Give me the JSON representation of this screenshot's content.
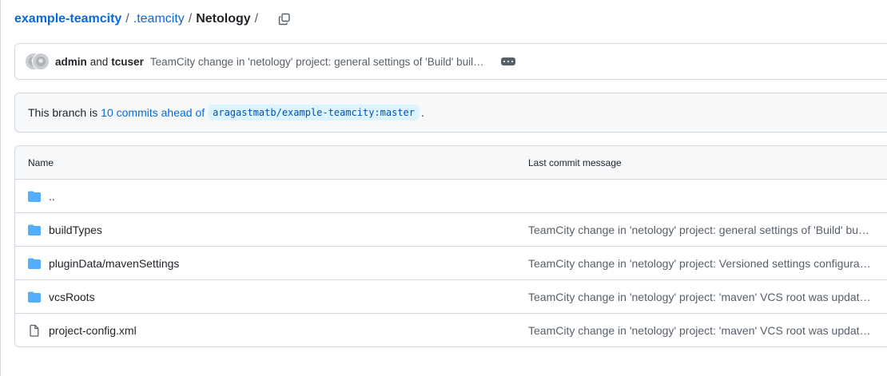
{
  "breadcrumb": {
    "repo": "example-teamcity",
    "sep1": "/",
    "folder": ".teamcity",
    "sep2": "/",
    "current": "Netology",
    "sep3": "/",
    "copy_icon": "copy-icon"
  },
  "commit": {
    "author1": "admin",
    "and": "and",
    "author2": "tcuser",
    "message": "TeamCity change in 'netology' project: general settings of 'Build' build configuration were updated",
    "more_icon": "ellipsis-icon"
  },
  "branch": {
    "prefix": "This branch is",
    "ahead": "10 commits ahead of",
    "ref": "aragastmatb/example-teamcity:master",
    "suffix": "."
  },
  "table": {
    "header_name": "Name",
    "header_msg": "Last commit message",
    "rows": [
      {
        "name": "..",
        "type": "folder",
        "message": ""
      },
      {
        "name": "buildTypes",
        "type": "folder",
        "message": "TeamCity change in 'netology' project: general settings of 'Build' build configuration were updated"
      },
      {
        "name": "pluginData/mavenSettings",
        "type": "folder",
        "message": "TeamCity change in 'netology' project: Versioned settings configuration updated"
      },
      {
        "name": "vcsRoots",
        "type": "folder",
        "message": "TeamCity change in 'netology' project: 'maven' VCS root was updated"
      },
      {
        "name": "project-config.xml",
        "type": "file",
        "message": "TeamCity change in 'netology' project: 'maven' VCS root was updated"
      }
    ]
  },
  "colors": {
    "link": "#0969da",
    "folder": "#54aeff",
    "muted": "#57606a"
  }
}
